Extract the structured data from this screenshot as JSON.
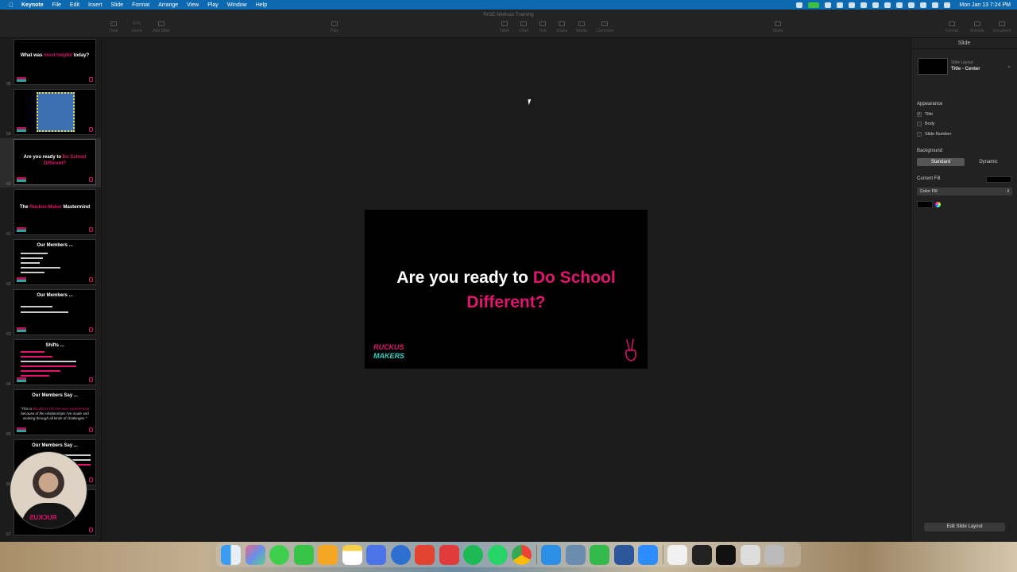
{
  "menubar": {
    "app_name": "Keynote",
    "menus": [
      "File",
      "Edit",
      "Insert",
      "Slide",
      "Format",
      "Arrange",
      "View",
      "Play",
      "Window",
      "Help"
    ],
    "clock": "Mon Jan 13  7:24 PM"
  },
  "window": {
    "doc_title": "RISE Method Training"
  },
  "toolbar": {
    "view": "View",
    "zoom": "Zoom",
    "zoom_value": "57%",
    "add_slide": "Add Slide",
    "play": "Play",
    "table": "Table",
    "chart": "Chart",
    "text": "Text",
    "shape": "Shape",
    "media": "Media",
    "comment": "Comment",
    "share": "Share",
    "format": "Format",
    "animate": "Animate",
    "document": "Document"
  },
  "navigator": {
    "slides": [
      {
        "num": "58",
        "title_a": "What was ",
        "title_pink": "most helpful",
        "title_b": " today?"
      },
      {
        "num": "59",
        "title_a": "",
        "title_pink": "",
        "title_b": ""
      },
      {
        "num": "60",
        "title_a": "Are you ready to ",
        "title_pink": "Do School Different?",
        "title_b": ""
      },
      {
        "num": "61",
        "title_a": "The ",
        "title_pink": "Ruckus Maker",
        "title_b": " Mastermind"
      },
      {
        "num": "62",
        "title_a": "Our Members ...",
        "title_pink": "",
        "title_b": ""
      },
      {
        "num": "63",
        "title_a": "Our Members ...",
        "title_pink": "",
        "title_b": ""
      },
      {
        "num": "64",
        "title_a": "Shifts ...",
        "title_pink": "",
        "title_b": ""
      },
      {
        "num": "65",
        "title_a": "Our Members Say ...",
        "title_pink": "",
        "title_b": ""
      },
      {
        "num": "66",
        "title_a": "Our Members Say ...",
        "title_pink": "",
        "title_b": ""
      },
      {
        "num": "67",
        "title_a": "",
        "title_pink": "",
        "title_b": ""
      }
    ],
    "slide65_quote_a": "\"This is ",
    "slide65_quote_pink": "the BEST PD I've ever experienced",
    "slide65_quote_b": " because of the relationships I've made and working through all kinds of challenges.\""
  },
  "slide": {
    "title_white": "Are you ready to ",
    "title_pink": "Do School Different?",
    "logo_line1": "RUCKUS",
    "logo_line2": "MAKERS"
  },
  "inspector": {
    "header": "Slide",
    "layout_label": "Slide Layout",
    "layout_value": "Title - Center",
    "appearance_label": "Appearance",
    "appearance_items": [
      {
        "label": "Title",
        "checked": true
      },
      {
        "label": "Body",
        "checked": false
      },
      {
        "label": "Slide Number",
        "checked": false
      }
    ],
    "background_label": "Background",
    "bg_standard": "Standard",
    "bg_dynamic": "Dynamic",
    "current_fill_label": "Current Fill",
    "fill_type": "Color Fill",
    "edit_layout_button": "Edit Slide Layout"
  },
  "colors": {
    "accent_pink": "#e1146e",
    "accent_teal": "#2fd2c4",
    "menubar_blue": "#0e6ab0"
  },
  "dock": {
    "apps": [
      "finder",
      "launchpad",
      "messages",
      "facetime",
      "pages",
      "notes",
      "perplexity",
      "1password",
      "todoist",
      "fantastical",
      "spotify",
      "whatsapp",
      "chrome",
      "keynote",
      "preview",
      "numbers",
      "word",
      "zoom",
      "document",
      "finder-window",
      "window-1",
      "window-2",
      "trash"
    ]
  }
}
